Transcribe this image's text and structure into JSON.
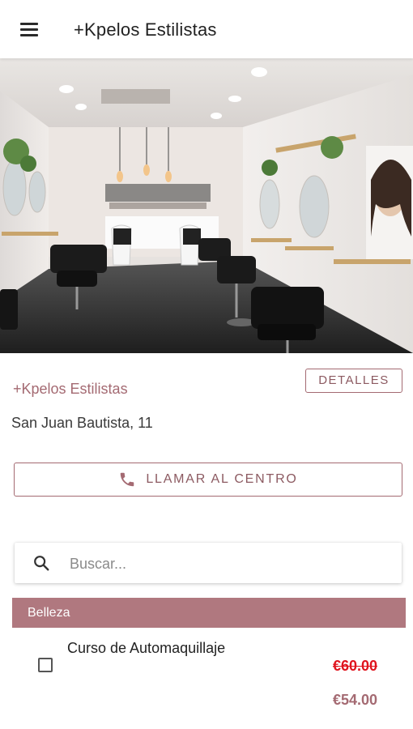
{
  "appbar": {
    "title": "+Kpelos Estilistas",
    "menu_icon": "menu-icon"
  },
  "hero": {
    "image": "salon-interior-photo"
  },
  "business": {
    "name": "+Kpelos Estilistas",
    "details_label": "DETALLES",
    "address": "San Juan Bautista, 11"
  },
  "call": {
    "label": "LLAMAR AL CENTRO",
    "icon": "phone-icon"
  },
  "search": {
    "placeholder": "Buscar...",
    "value": "",
    "icon": "search-icon"
  },
  "categories": [
    {
      "name": "Belleza",
      "services": [
        {
          "title": "Curso de Automaquillaje",
          "checked": false,
          "original_price": "€60.00",
          "price": "€54.00"
        }
      ]
    }
  ],
  "colors": {
    "accent": "#a46a72",
    "category_bg": "#b0787f",
    "strike_price": "#e0141e"
  }
}
